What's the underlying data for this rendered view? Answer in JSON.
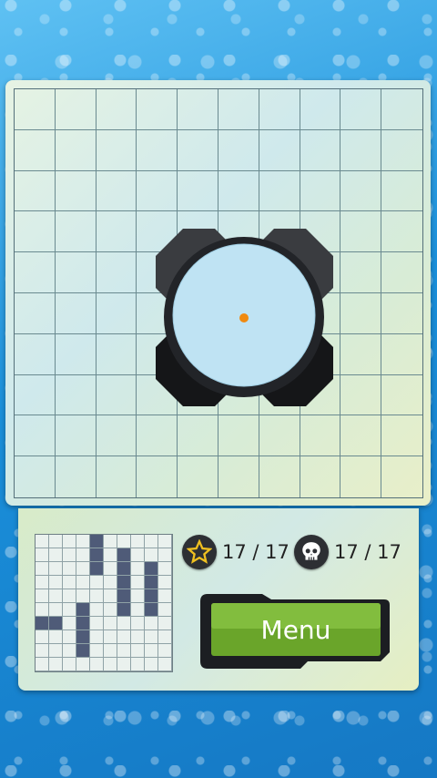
{
  "stats": {
    "stars": "17 / 17",
    "skulls": "17 / 17"
  },
  "menu": {
    "label": "Menu"
  },
  "minimap": {
    "rows": 10,
    "cols": 10,
    "filled": [
      [
        0,
        4
      ],
      [
        1,
        4
      ],
      [
        2,
        4
      ],
      [
        1,
        6
      ],
      [
        2,
        6
      ],
      [
        3,
        6
      ],
      [
        2,
        8
      ],
      [
        3,
        8
      ],
      [
        4,
        6
      ],
      [
        5,
        6
      ],
      [
        4,
        8
      ],
      [
        5,
        8
      ],
      [
        5,
        3
      ],
      [
        6,
        3
      ],
      [
        6,
        0
      ],
      [
        6,
        1
      ],
      [
        7,
        3
      ],
      [
        8,
        3
      ]
    ]
  },
  "icons": {
    "star": "star-icon",
    "skull": "skull-icon"
  }
}
